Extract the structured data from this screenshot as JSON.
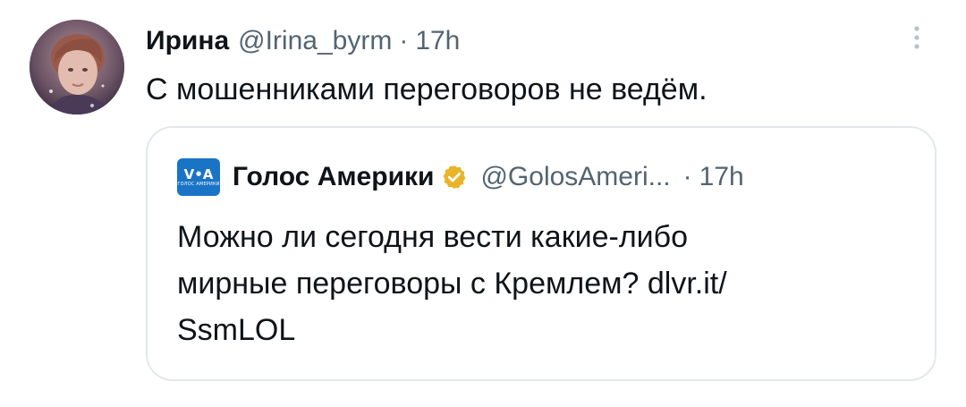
{
  "tweet": {
    "author_name": "Ирина",
    "handle": "@Irina_byrm",
    "separator": "·",
    "time": "17h",
    "text": "С мошенниками переговоров не ведём."
  },
  "quoted": {
    "logo_text": "V•A",
    "logo_subtext": "ГОЛОС АМЕРИКИ",
    "author_name": "Голос Америки",
    "handle": "@GolosAmeri...",
    "separator": "·",
    "time": "17h",
    "text_lines": [
      "Можно ли сегодня вести какие-либо",
      "мирные переговоры с Кремлем? dlvr.it/",
      "SsmLOL"
    ]
  },
  "icons": {
    "more": "more-vertical-icon",
    "verified": "verified-badge-icon"
  },
  "colors": {
    "text_primary": "#0f1419",
    "text_secondary": "#536471",
    "border": "#e3e8ec",
    "verified_gold": "#e8b429",
    "voa_blue": "#1a74c6"
  }
}
